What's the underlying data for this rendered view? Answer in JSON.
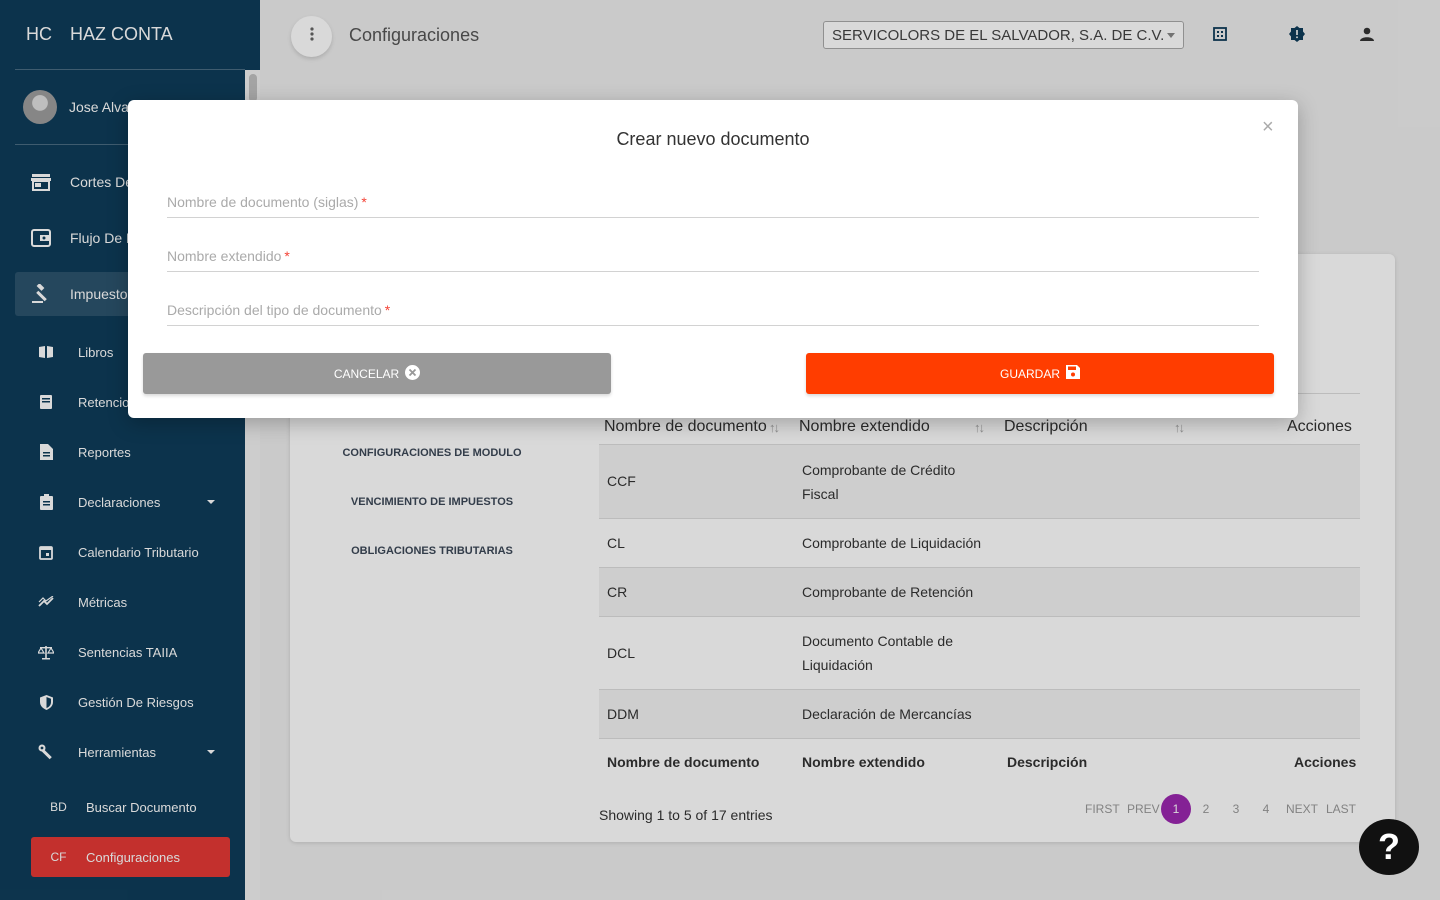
{
  "sidebar": {
    "logo_abbr": "HC",
    "logo_name": "HAZ CONTA",
    "user_name": "Jose Alva",
    "items": [
      {
        "label": "Cortes De"
      },
      {
        "label": "Flujo De E"
      },
      {
        "label": "Impuesto"
      }
    ],
    "sub_items": [
      {
        "label": "Libros"
      },
      {
        "label": "Retencio"
      },
      {
        "label": "Reportes"
      },
      {
        "label": "Declaraciones"
      },
      {
        "label": "Calendario Tributario"
      },
      {
        "label": "Métricas"
      },
      {
        "label": "Sentencias TAIIA"
      },
      {
        "label": "Gestión De Riesgos"
      },
      {
        "label": "Herramientas"
      }
    ],
    "mini_items": [
      {
        "abbr": "BD",
        "label": "Buscar Documento"
      },
      {
        "abbr": "CF",
        "label": "Configuraciones"
      }
    ]
  },
  "topbar": {
    "title": "Configuraciones",
    "company": "SERVICOLORS DE EL SALVADOR, S.A. DE C.V."
  },
  "card": {
    "tabs": [
      "CONFIGURACIONES DE MODULO",
      "VENCIMIENTO DE IMPUESTOS",
      "OBLIGACIONES TRIBUTARIAS"
    ],
    "columns": [
      "Nombre de documento",
      "Nombre extendido",
      "Descripción",
      "Acciones"
    ],
    "rows": [
      {
        "code": "CCF",
        "name": "Comprobante de Crédito Fiscal"
      },
      {
        "code": "CL",
        "name": "Comprobante de Liquidación"
      },
      {
        "code": "CR",
        "name": "Comprobante de Retención"
      },
      {
        "code": "DCL",
        "name": "Documento Contable de Liquidación"
      },
      {
        "code": "DDM",
        "name": "Declaración de Mercancías"
      }
    ],
    "showing": "Showing 1 to 5 of 17 entries",
    "pager": {
      "first": "FIRST",
      "prev": "PREV",
      "pages": [
        "1",
        "2",
        "3",
        "4"
      ],
      "next": "NEXT",
      "last": "LAST"
    }
  },
  "modal": {
    "title": "Crear nuevo documento",
    "close": "×",
    "fields": [
      {
        "label": "Nombre de documento (siglas)",
        "req": "*"
      },
      {
        "label": "Nombre extendido",
        "req": "*"
      },
      {
        "label": "Descripción del tipo de documento",
        "req": "*"
      }
    ],
    "cancel_label": "CANCELAR",
    "save_label": "GUARDAR"
  },
  "help": "?"
}
